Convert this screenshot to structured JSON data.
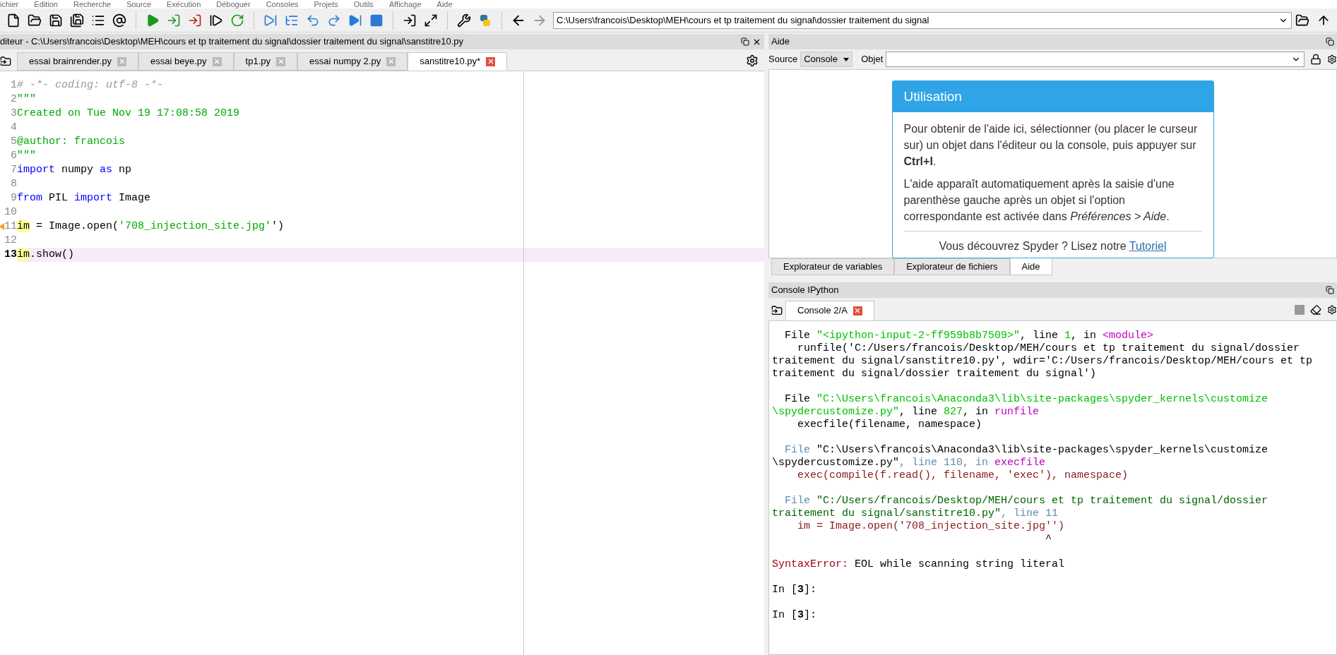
{
  "menu": [
    "ichier",
    "Edition",
    "Recherche",
    "Source",
    "Exécution",
    "Déboguer",
    "Consoles",
    "Projets",
    "Outils",
    "Affichage",
    "Aide"
  ],
  "toolbar": {
    "path": "C:\\Users\\francois\\Desktop\\MEH\\cours et tp traitement du signal\\dossier traitement du signal"
  },
  "editor": {
    "title": "diteur - C:\\Users\\francois\\Desktop\\MEH\\cours et tp traitement du signal\\dossier traitement du signal\\sanstitre10.py",
    "tabs": [
      {
        "label": "essai brainrender.py",
        "selected": false
      },
      {
        "label": "essai beye.py",
        "selected": false
      },
      {
        "label": "tp1.py",
        "selected": false
      },
      {
        "label": "essai numpy 2.py",
        "selected": false
      },
      {
        "label": "sanstitre10.py*",
        "selected": true
      }
    ],
    "lines": [
      {
        "number": "1",
        "warning": false,
        "current": false,
        "segments": [
          {
            "kind": "comment",
            "text": "# -*- coding: utf-8 -*-"
          }
        ]
      },
      {
        "number": "2",
        "warning": false,
        "current": false,
        "segments": [
          {
            "kind": "str",
            "text": "\"\"\""
          }
        ]
      },
      {
        "number": "3",
        "warning": false,
        "current": false,
        "segments": [
          {
            "kind": "str",
            "text": "Created on Tue Nov 19 17:08:58 2019"
          }
        ]
      },
      {
        "number": "4",
        "warning": false,
        "current": false
      },
      {
        "number": "5",
        "warning": false,
        "current": false,
        "segments": [
          {
            "kind": "str",
            "text": "@author: francois"
          }
        ]
      },
      {
        "number": "6",
        "warning": false,
        "current": false,
        "segments": [
          {
            "kind": "str",
            "text": "\"\"\""
          }
        ]
      },
      {
        "number": "7",
        "warning": false,
        "current": false,
        "segments": [
          {
            "kind": "kw",
            "text": "import"
          },
          {
            "kind": "plain",
            "text": " numpy "
          },
          {
            "kind": "kw",
            "text": "as"
          },
          {
            "kind": "plain",
            "text": " np"
          }
        ]
      },
      {
        "number": "8",
        "warning": false,
        "current": false
      },
      {
        "number": "9",
        "warning": false,
        "current": false,
        "segments": [
          {
            "kind": "kw",
            "text": "from"
          },
          {
            "kind": "plain",
            "text": " PIL "
          },
          {
            "kind": "kw",
            "text": "import"
          },
          {
            "kind": "plain",
            "text": " Image"
          }
        ]
      },
      {
        "number": "10",
        "warning": false,
        "current": false
      },
      {
        "number": "11",
        "warning": true,
        "current": false,
        "segments": [
          {
            "kind": "occurrence",
            "text": "im"
          },
          {
            "kind": "plain",
            "text": " = Image.open("
          },
          {
            "kind": "str",
            "text": "'708_injection_site.jpg'"
          },
          {
            "kind": "plain",
            "text": "')"
          }
        ]
      },
      {
        "number": "12",
        "warning": false,
        "current": false
      },
      {
        "number": "13",
        "warning": false,
        "current": true,
        "segments": [
          {
            "kind": "occurrence",
            "text": "im"
          },
          {
            "kind": "plain",
            "text": ".show()"
          }
        ]
      }
    ]
  },
  "help": {
    "title": "Aide",
    "source_label": "Source",
    "source_value": "Console",
    "object_label": "Objet",
    "card": {
      "title": "Utilisation",
      "paragraphs": [
        "Pour obtenir de l'aide ici, sélectionner (ou placer le curseur sur) un objet dans l'éditeur ou la console, puis appuyer sur **Ctrl+I**.",
        "L'aide apparaît automatiquement après la saisie d'une parenthèse gauche après un objet si l'option correspondante est activée dans *Préférences > Aide*."
      ],
      "footer": "Vous découvrez Spyder ? Lisez notre",
      "link": "Tutoriel"
    },
    "tabs": [
      {
        "label": "Explorateur de variables",
        "selected": false
      },
      {
        "label": "Explorateur de fichiers",
        "selected": false
      },
      {
        "label": "Aide",
        "selected": true
      }
    ]
  },
  "console": {
    "title": "Console IPython",
    "tabs": [
      {
        "label": "Console 2/A",
        "selected": true
      }
    ],
    "blocks": [
      [
        [
          {
            "kind": "plain",
            "text": "  File "
          },
          {
            "kind": "str",
            "text": "\"<ipython-input-2-ff959b8b7509>\""
          },
          {
            "kind": "plain",
            "text": ", line "
          },
          {
            "kind": "num",
            "text": "1"
          },
          {
            "kind": "plain",
            "text": ", in "
          },
          {
            "kind": "name",
            "text": "<module>"
          }
        ],
        [
          {
            "kind": "plain",
            "text": "    runfile('C:/Users/francois/Desktop/MEH/cours et tp traitement du signal/dossier"
          }
        ],
        [
          {
            "kind": "plain",
            "text": "traitement du signal/sanstitre10.py', wdir='C:/Users/francois/Desktop/MEH/cours et tp"
          }
        ],
        [
          {
            "kind": "plain",
            "text": "traitement du signal/dossier traitement du signal')"
          }
        ]
      ],
      [
        [
          {
            "kind": "plain",
            "text": "  File "
          },
          {
            "kind": "str",
            "text": "\"C:\\Users\\francois\\Anaconda3\\lib\\site-packages\\spyder_kernels\\customize"
          }
        ],
        [
          {
            "kind": "str",
            "text": "\\spydercustomize.py\""
          },
          {
            "kind": "plain",
            "text": ", line "
          },
          {
            "kind": "num",
            "text": "827"
          },
          {
            "kind": "plain",
            "text": ", in "
          },
          {
            "kind": "name",
            "text": "runfile"
          }
        ],
        [
          {
            "kind": "plain",
            "text": "    execfile(filename, namespace)"
          }
        ]
      ],
      [
        [
          {
            "kind": "dim",
            "text": "  File "
          },
          {
            "kind": "plain",
            "text": "\"C:\\Users\\francois\\Anaconda3\\lib\\site-packages\\spyder_kernels\\customize"
          }
        ],
        [
          {
            "kind": "plain",
            "text": "\\spydercustomize.py\""
          },
          {
            "kind": "dim",
            "text": ", line 110, in "
          },
          {
            "kind": "name",
            "text": "execfile"
          }
        ],
        [
          {
            "kind": "code",
            "text": "    exec(compile(f.read(), filename, 'exec'), namespace)"
          }
        ]
      ],
      [
        [
          {
            "kind": "dim",
            "text": "  File "
          },
          {
            "kind": "dstr",
            "text": "\"C:/Users/francois/Desktop/MEH/cours et tp traitement du signal/dossier"
          }
        ],
        [
          {
            "kind": "dstr",
            "text": "traitement du signal/sanstitre10.py\""
          },
          {
            "kind": "dim",
            "text": ", line 11"
          }
        ],
        [
          {
            "kind": "code",
            "text": "    im = Image.open('708_injection_site.jpg'')"
          }
        ],
        [
          {
            "kind": "plain",
            "text": "                                           ^"
          }
        ]
      ],
      [
        [
          {
            "kind": "err",
            "text": "SyntaxError:"
          },
          {
            "kind": "plain",
            "text": " EOL while scanning string literal"
          }
        ]
      ],
      [
        [
          {
            "kind": "plain",
            "text": "In ["
          },
          {
            "kind": "bold",
            "text": "3"
          },
          {
            "kind": "plain",
            "text": "]:"
          }
        ]
      ],
      [
        [
          {
            "kind": "plain",
            "text": "In ["
          },
          {
            "kind": "bold",
            "text": "3"
          },
          {
            "kind": "plain",
            "text": "]:"
          }
        ]
      ]
    ]
  }
}
